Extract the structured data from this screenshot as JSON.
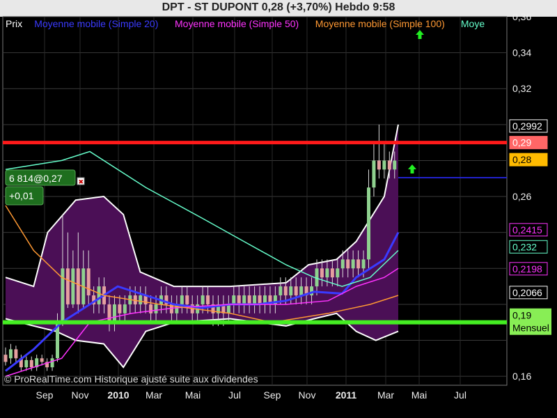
{
  "header": {
    "title": "DPT - ST DUPONT      0,28 (+3,70%)      Hebdo  9:58"
  },
  "legend": [
    {
      "label": "Prix",
      "color": "#ffffff"
    },
    {
      "label": "Moyenne mobile (Simple 20)",
      "color": "#3a3aff"
    },
    {
      "label": "Moyenne mobile (Simple 50)",
      "color": "#ff33ff"
    },
    {
      "label": "Moyenne mobile (Simple 100)",
      "color": "#ff9933"
    },
    {
      "label": "Moye",
      "color": "#66ffcc"
    }
  ],
  "order_box": {
    "line1": "6 814@0,27",
    "line2": "+0,01"
  },
  "watermark": "© ProRealTime.com Historique ajusté suite aux dividendes",
  "alert_label": {
    "value": "0,19",
    "period": "Mensuel"
  },
  "colors": {
    "background": "#000000",
    "bollinger_fill": "#4b0f56",
    "bollinger_edge": "#ffffff",
    "up_candle": "#8fd18f",
    "down_candle": "#e5a0a0",
    "resistance": "#ff1a1a",
    "support": "#44ee22",
    "ma20": "#3a3aff",
    "ma50": "#ff33ff",
    "ma100": "#ff9933",
    "ma200": "#66ffcc",
    "current_line": "#2222cc"
  },
  "chart_data": {
    "type": "candlestick",
    "timeframe": "weekly",
    "x_tick_labels": [
      "Sep",
      "Nov",
      "2010",
      "Mar",
      "Mai",
      "Jul",
      "Sep",
      "Nov",
      "2011",
      "Mar",
      "Mai",
      "Jul"
    ],
    "ylim": [
      0.155,
      0.36
    ],
    "y_tick_labels": [
      "0,36",
      "0,34",
      "0,32",
      "0,26",
      "0,16"
    ],
    "price_labels": [
      {
        "text": "0,2992",
        "value": 0.2992,
        "bg": "#000000",
        "fg": "#ffffff",
        "border": "#ffffff"
      },
      {
        "text": "0,29",
        "value": 0.29,
        "bg": "#ff6666",
        "fg": "#ffffff",
        "border": "#ff6666"
      },
      {
        "text": "0,28",
        "value": 0.2805,
        "bg": "#ffbb00",
        "fg": "#000000",
        "border": "#ffbb00"
      },
      {
        "text": "0,2415",
        "value": 0.2415,
        "bg": "#000000",
        "fg": "#ff33ff",
        "border": "#ff33ff"
      },
      {
        "text": "0,232",
        "value": 0.232,
        "bg": "#000000",
        "fg": "#66ffcc",
        "border": "#66ffcc"
      },
      {
        "text": "0,2198",
        "value": 0.2198,
        "bg": "#000000",
        "fg": "#ff33ff",
        "border": "#ff33ff"
      },
      {
        "text": "0,2066",
        "value": 0.2066,
        "bg": "#000000",
        "fg": "#ffffff",
        "border": "#ffffff"
      }
    ],
    "resistance_level": 0.29,
    "support_level": 0.19,
    "last_price": 0.28,
    "series": [
      {
        "name": "Moyenne mobile (Simple 20)",
        "color": "#3a3aff",
        "points": [
          [
            0,
            0.163
          ],
          [
            10,
            0.175
          ],
          [
            20,
            0.19
          ],
          [
            30,
            0.2
          ],
          [
            40,
            0.21
          ],
          [
            50,
            0.205
          ],
          [
            60,
            0.2
          ],
          [
            70,
            0.198
          ],
          [
            80,
            0.2
          ],
          [
            90,
            0.2
          ],
          [
            100,
            0.202
          ],
          [
            110,
            0.207
          ],
          [
            120,
            0.206
          ],
          [
            125,
            0.215
          ],
          [
            135,
            0.225
          ],
          [
            140,
            0.24
          ]
        ]
      },
      {
        "name": "Moyenne mobile (Simple 50)",
        "color": "#ff33ff",
        "points": [
          [
            0,
            0.16
          ],
          [
            20,
            0.17
          ],
          [
            30,
            0.19
          ],
          [
            45,
            0.195
          ],
          [
            60,
            0.198
          ],
          [
            80,
            0.2
          ],
          [
            100,
            0.2
          ],
          [
            115,
            0.202
          ],
          [
            125,
            0.21
          ],
          [
            135,
            0.215
          ],
          [
            140,
            0.22
          ]
        ]
      },
      {
        "name": "Moyenne mobile (Simple 100)",
        "color": "#ff9933",
        "points": [
          [
            0,
            0.255
          ],
          [
            10,
            0.23
          ],
          [
            20,
            0.215
          ],
          [
            35,
            0.205
          ],
          [
            55,
            0.2
          ],
          [
            80,
            0.195
          ],
          [
            95,
            0.19
          ],
          [
            115,
            0.195
          ],
          [
            130,
            0.2
          ],
          [
            140,
            0.205
          ]
        ]
      },
      {
        "name": "Moye",
        "color": "#66ffcc",
        "points": [
          [
            0,
            0.275
          ],
          [
            20,
            0.28
          ],
          [
            30,
            0.285
          ],
          [
            50,
            0.265
          ],
          [
            70,
            0.248
          ],
          [
            85,
            0.235
          ],
          [
            100,
            0.222
          ],
          [
            110,
            0.215
          ],
          [
            120,
            0.21
          ],
          [
            130,
            0.215
          ],
          [
            140,
            0.23
          ]
        ]
      }
    ],
    "bollinger": {
      "upper": [
        [
          0,
          0.215
        ],
        [
          10,
          0.21
        ],
        [
          15,
          0.24
        ],
        [
          25,
          0.258
        ],
        [
          35,
          0.26
        ],
        [
          42,
          0.25
        ],
        [
          48,
          0.218
        ],
        [
          60,
          0.21
        ],
        [
          80,
          0.21
        ],
        [
          100,
          0.212
        ],
        [
          108,
          0.222
        ],
        [
          118,
          0.225
        ],
        [
          125,
          0.235
        ],
        [
          135,
          0.26
        ],
        [
          140,
          0.3
        ]
      ],
      "lower": [
        [
          0,
          0.192
        ],
        [
          10,
          0.188
        ],
        [
          18,
          0.185
        ],
        [
          25,
          0.18
        ],
        [
          35,
          0.178
        ],
        [
          42,
          0.165
        ],
        [
          50,
          0.185
        ],
        [
          60,
          0.19
        ],
        [
          80,
          0.192
        ],
        [
          100,
          0.188
        ],
        [
          110,
          0.192
        ],
        [
          118,
          0.195
        ],
        [
          125,
          0.185
        ],
        [
          132,
          0.18
        ],
        [
          140,
          0.185
        ]
      ]
    },
    "candles": [
      [
        0,
        0.172,
        0.168,
        0.176,
        0.166
      ],
      [
        1,
        0.17,
        0.175,
        0.178,
        0.167
      ],
      [
        2,
        0.175,
        0.17,
        0.177,
        0.168
      ],
      [
        3,
        0.17,
        0.165,
        0.172,
        0.163
      ],
      [
        4,
        0.165,
        0.169,
        0.171,
        0.163
      ],
      [
        5,
        0.169,
        0.165,
        0.171,
        0.163
      ],
      [
        6,
        0.165,
        0.17,
        0.172,
        0.163
      ],
      [
        7,
        0.17,
        0.168,
        0.172,
        0.166
      ],
      [
        8,
        0.168,
        0.165,
        0.17,
        0.163
      ],
      [
        9,
        0.165,
        0.17,
        0.172,
        0.163
      ],
      [
        10,
        0.17,
        0.19,
        0.195,
        0.168
      ],
      [
        11,
        0.19,
        0.22,
        0.25,
        0.188
      ],
      [
        12,
        0.22,
        0.2,
        0.24,
        0.198
      ],
      [
        13,
        0.2,
        0.22,
        0.23,
        0.198
      ],
      [
        14,
        0.22,
        0.2,
        0.24,
        0.195
      ],
      [
        15,
        0.2,
        0.22,
        0.23,
        0.198
      ],
      [
        16,
        0.22,
        0.205,
        0.23,
        0.2
      ],
      [
        17,
        0.205,
        0.2,
        0.21,
        0.195
      ],
      [
        18,
        0.2,
        0.21,
        0.215,
        0.195
      ],
      [
        19,
        0.21,
        0.2,
        0.215,
        0.195
      ],
      [
        20,
        0.2,
        0.19,
        0.205,
        0.185
      ],
      [
        21,
        0.19,
        0.2,
        0.205,
        0.185
      ],
      [
        22,
        0.2,
        0.195,
        0.205,
        0.19
      ],
      [
        23,
        0.195,
        0.2,
        0.205,
        0.19
      ],
      [
        24,
        0.2,
        0.205,
        0.21,
        0.195
      ],
      [
        25,
        0.205,
        0.2,
        0.21,
        0.195
      ],
      [
        26,
        0.2,
        0.205,
        0.21,
        0.195
      ],
      [
        27,
        0.205,
        0.2,
        0.21,
        0.195
      ],
      [
        28,
        0.2,
        0.195,
        0.205,
        0.19
      ],
      [
        29,
        0.195,
        0.2,
        0.205,
        0.19
      ],
      [
        30,
        0.2,
        0.205,
        0.21,
        0.195
      ],
      [
        31,
        0.205,
        0.2,
        0.21,
        0.195
      ],
      [
        32,
        0.2,
        0.195,
        0.205,
        0.19
      ],
      [
        33,
        0.195,
        0.2,
        0.205,
        0.19
      ],
      [
        34,
        0.2,
        0.205,
        0.21,
        0.195
      ],
      [
        35,
        0.205,
        0.2,
        0.21,
        0.195
      ],
      [
        36,
        0.2,
        0.195,
        0.205,
        0.19
      ],
      [
        37,
        0.195,
        0.2,
        0.205,
        0.19
      ],
      [
        38,
        0.2,
        0.205,
        0.21,
        0.195
      ],
      [
        39,
        0.205,
        0.2,
        0.21,
        0.195
      ],
      [
        40,
        0.2,
        0.195,
        0.205,
        0.188
      ],
      [
        41,
        0.195,
        0.2,
        0.205,
        0.188
      ],
      [
        42,
        0.2,
        0.195,
        0.205,
        0.188
      ],
      [
        43,
        0.195,
        0.2,
        0.205,
        0.19
      ],
      [
        44,
        0.2,
        0.205,
        0.21,
        0.195
      ],
      [
        45,
        0.205,
        0.2,
        0.21,
        0.195
      ],
      [
        46,
        0.2,
        0.205,
        0.21,
        0.195
      ],
      [
        47,
        0.205,
        0.2,
        0.21,
        0.195
      ],
      [
        48,
        0.2,
        0.205,
        0.21,
        0.195
      ],
      [
        49,
        0.205,
        0.2,
        0.21,
        0.195
      ],
      [
        50,
        0.2,
        0.205,
        0.21,
        0.195
      ],
      [
        51,
        0.205,
        0.2,
        0.21,
        0.195
      ],
      [
        52,
        0.2,
        0.205,
        0.21,
        0.195
      ],
      [
        53,
        0.205,
        0.21,
        0.215,
        0.2
      ],
      [
        54,
        0.21,
        0.205,
        0.215,
        0.2
      ],
      [
        55,
        0.205,
        0.21,
        0.215,
        0.2
      ],
      [
        56,
        0.21,
        0.205,
        0.215,
        0.2
      ],
      [
        57,
        0.205,
        0.21,
        0.215,
        0.2
      ],
      [
        58,
        0.21,
        0.205,
        0.215,
        0.2
      ],
      [
        59,
        0.205,
        0.21,
        0.215,
        0.2
      ],
      [
        60,
        0.21,
        0.22,
        0.225,
        0.205
      ],
      [
        61,
        0.22,
        0.215,
        0.225,
        0.21
      ],
      [
        62,
        0.215,
        0.22,
        0.225,
        0.21
      ],
      [
        63,
        0.22,
        0.215,
        0.225,
        0.21
      ],
      [
        64,
        0.215,
        0.22,
        0.225,
        0.21
      ],
      [
        65,
        0.22,
        0.225,
        0.23,
        0.215
      ],
      [
        66,
        0.225,
        0.22,
        0.23,
        0.215
      ],
      [
        67,
        0.22,
        0.225,
        0.23,
        0.215
      ],
      [
        68,
        0.225,
        0.22,
        0.23,
        0.215
      ],
      [
        69,
        0.22,
        0.225,
        0.23,
        0.215
      ],
      [
        70,
        0.225,
        0.265,
        0.275,
        0.22
      ],
      [
        71,
        0.265,
        0.28,
        0.29,
        0.26
      ],
      [
        72,
        0.28,
        0.275,
        0.3,
        0.27
      ],
      [
        73,
        0.275,
        0.28,
        0.29,
        0.27
      ],
      [
        74,
        0.28,
        0.275,
        0.285,
        0.27
      ],
      [
        75,
        0.275,
        0.28,
        0.285,
        0.27
      ]
    ]
  }
}
